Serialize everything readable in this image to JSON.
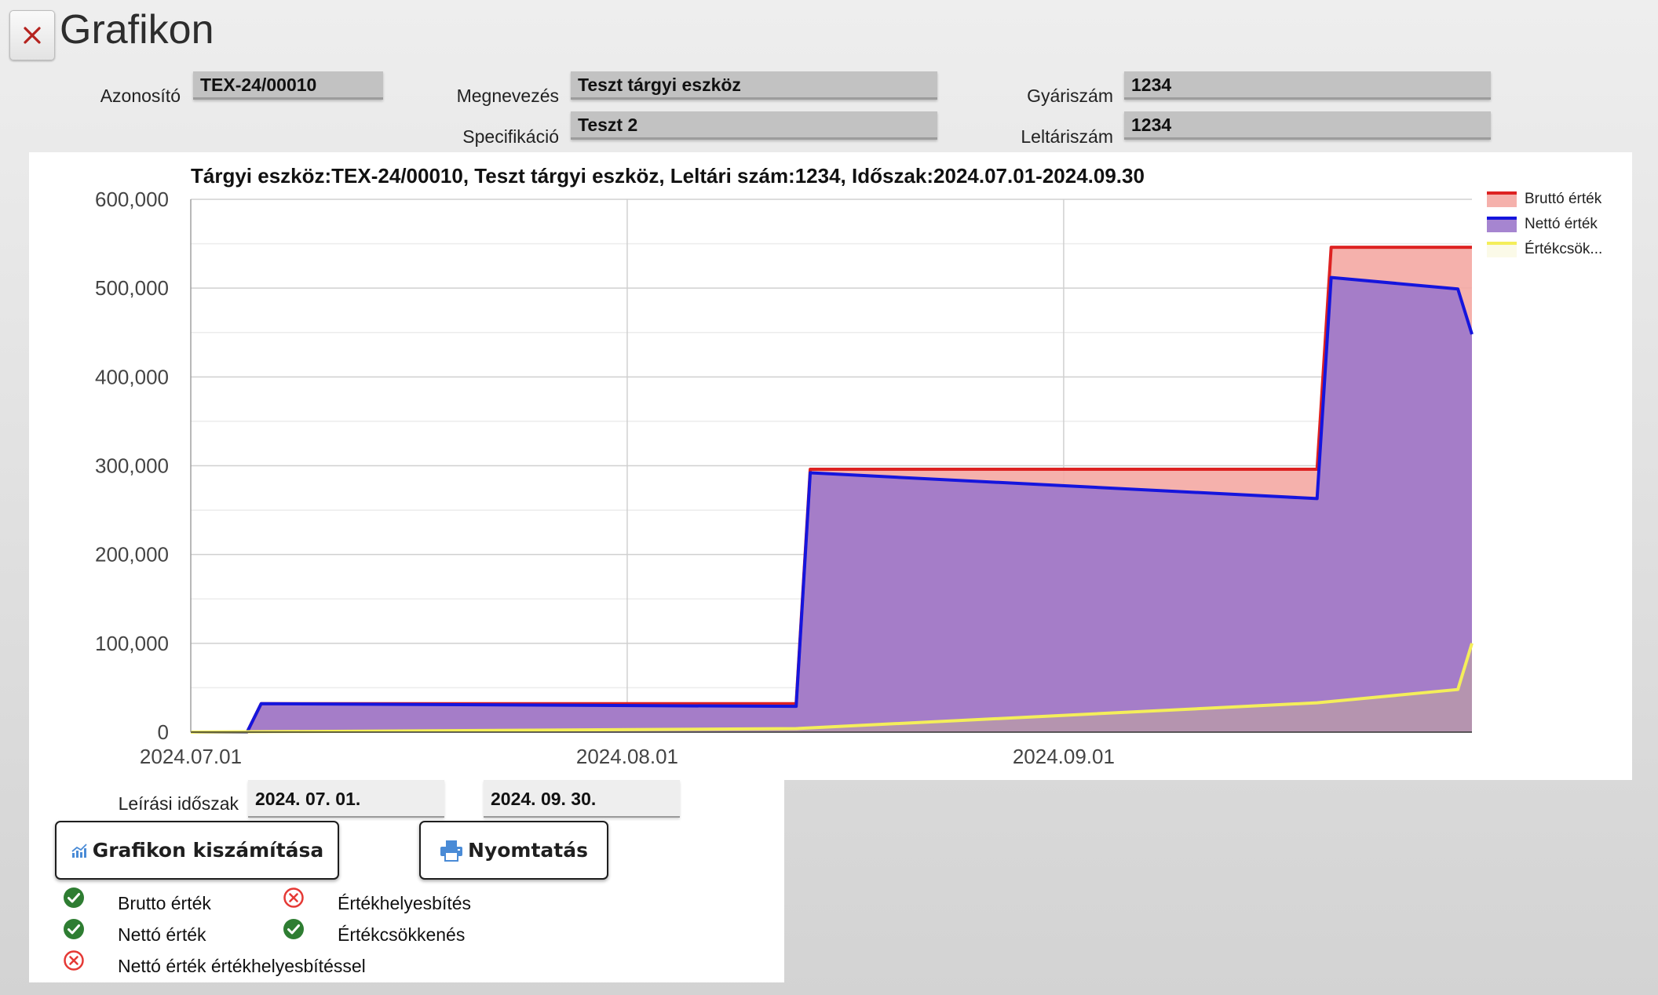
{
  "header": {
    "title": "Grafikon"
  },
  "fields": {
    "azonosito": {
      "label": "Azonosító",
      "value": "TEX-24/00010"
    },
    "megnevezes": {
      "label": "Megnevezés",
      "value": "Teszt tárgyi eszköz"
    },
    "specifikacio": {
      "label": "Specifikáció",
      "value": "Teszt 2"
    },
    "gyariszam": {
      "label": "Gyáriszám",
      "value": "1234"
    },
    "leltariszam": {
      "label": "Leltáriszám",
      "value": "1234"
    }
  },
  "chart_data": {
    "type": "area",
    "title": "Tárgyi eszköz:TEX-24/00010, Teszt tárgyi eszköz, Leltári szám:1234, Időszak:2024.07.01-2024.09.30",
    "x_ticks": [
      "2024.07.01",
      "2024.08.01",
      "2024.09.01"
    ],
    "y_ticks": [
      "0",
      "100,000",
      "200,000",
      "300,000",
      "400,000",
      "500,000",
      "600,000"
    ],
    "xlim": [
      "2024.07.01",
      "2024.09.30"
    ],
    "ylim": [
      0,
      600000
    ],
    "grid": true,
    "legend_position": "right",
    "series": [
      {
        "name": "Bruttó érték",
        "color": "#dd2222",
        "fill": "#f4a9a3",
        "x": [
          "2024.07.01",
          "2024.07.05",
          "2024.07.06",
          "2024.08.13",
          "2024.08.14",
          "2024.09.19",
          "2024.09.20",
          "2024.09.30"
        ],
        "values": [
          0,
          0,
          32000,
          32000,
          296000,
          296000,
          546000,
          546000
        ]
      },
      {
        "name": "Nettó érték",
        "color": "#1515dd",
        "fill": "#9c78cb",
        "x": [
          "2024.07.01",
          "2024.07.05",
          "2024.07.06",
          "2024.08.13",
          "2024.08.14",
          "2024.09.19",
          "2024.09.20",
          "2024.09.29",
          "2024.09.30"
        ],
        "values": [
          0,
          0,
          32000,
          29000,
          292000,
          263000,
          512000,
          499000,
          448000
        ]
      },
      {
        "name": "Értékcsök...",
        "color": "#f4ee5a",
        "fill": "rgba(230,220,100,0.25)",
        "x": [
          "2024.07.01",
          "2024.08.13",
          "2024.09.19",
          "2024.09.29",
          "2024.09.30"
        ],
        "values": [
          0,
          4000,
          33000,
          48000,
          100000
        ]
      }
    ]
  },
  "period": {
    "label": "Leírási időszak",
    "from": "2024. 07. 01.",
    "to": "2024. 09. 30."
  },
  "buttons": {
    "calculate": "Grafikon kiszámítása",
    "print": "Nyomtatás"
  },
  "options": [
    {
      "label": "Brutto érték",
      "checked": true
    },
    {
      "label": "Értékhelyesbítés",
      "checked": false
    },
    {
      "label": "Nettó érték",
      "checked": true
    },
    {
      "label": "Értékcsökkenés",
      "checked": true
    },
    {
      "label": "Nettó érték értékhelyesbítéssel",
      "checked": false
    }
  ],
  "colors": {
    "check_on": "#2e7d32",
    "check_off": "#e53935"
  }
}
